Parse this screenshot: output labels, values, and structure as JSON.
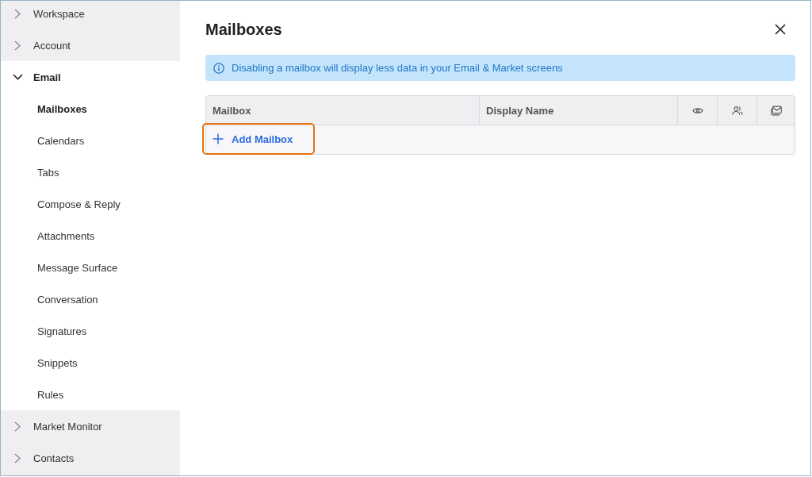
{
  "sidebar": {
    "sections": [
      {
        "label": "Workspace",
        "expanded": false
      },
      {
        "label": "Account",
        "expanded": false
      },
      {
        "label": "Email",
        "expanded": true,
        "children": [
          {
            "label": "Mailboxes",
            "selected": true
          },
          {
            "label": "Calendars",
            "selected": false
          },
          {
            "label": "Tabs",
            "selected": false
          },
          {
            "label": "Compose & Reply",
            "selected": false
          },
          {
            "label": "Attachments",
            "selected": false
          },
          {
            "label": "Message Surface",
            "selected": false
          },
          {
            "label": "Conversation",
            "selected": false
          },
          {
            "label": "Signatures",
            "selected": false
          },
          {
            "label": "Snippets",
            "selected": false
          },
          {
            "label": "Rules",
            "selected": false
          }
        ]
      },
      {
        "label": "Market Monitor",
        "expanded": false
      },
      {
        "label": "Contacts",
        "expanded": false
      }
    ]
  },
  "panel": {
    "title": "Mailboxes",
    "banner": {
      "text": "Disabling a mailbox will display less data in your Email & Market screens"
    },
    "table": {
      "columns": [
        {
          "kind": "text",
          "label": "Mailbox"
        },
        {
          "kind": "text",
          "label": "Display Name"
        },
        {
          "kind": "icon"
        },
        {
          "kind": "icon"
        },
        {
          "kind": "icon"
        }
      ],
      "add_button": {
        "label": "Add Mailbox",
        "focused": true
      }
    }
  }
}
